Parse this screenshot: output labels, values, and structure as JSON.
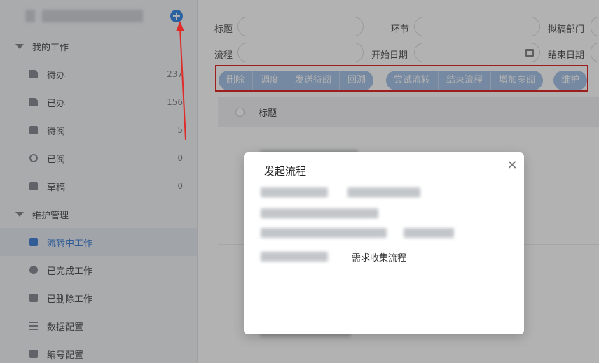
{
  "sidebar": {
    "add_icon": "plus-icon",
    "groups": [
      {
        "label": "我的工作"
      },
      {
        "label": "维护管理"
      }
    ],
    "my_work_items": [
      {
        "label": "待办",
        "count": "237",
        "icon": "document-icon"
      },
      {
        "label": "已办",
        "count": "156",
        "icon": "documents-icon"
      },
      {
        "label": "待阅",
        "count": "5",
        "icon": "clock-icon"
      },
      {
        "label": "已阅",
        "count": "0",
        "icon": "eye-icon"
      },
      {
        "label": "草稿",
        "count": "0",
        "icon": "draft-icon"
      }
    ],
    "maintenance_items": [
      {
        "label": "流转中工作",
        "icon": "monitor-icon",
        "active": true
      },
      {
        "label": "已完成工作",
        "icon": "check-circle-icon"
      },
      {
        "label": "已删除工作",
        "icon": "trash-icon"
      },
      {
        "label": "数据配置",
        "icon": "sliders-icon"
      },
      {
        "label": "编号配置",
        "icon": "clipboard-icon"
      }
    ]
  },
  "filters": {
    "title_label": "标题",
    "stage_label": "环节",
    "dept_label": "拟稿部门",
    "flow_label": "流程",
    "start_date_label": "开始日期",
    "end_date_label": "结束日期"
  },
  "toolbar": {
    "group1": [
      "删除",
      "调度",
      "发送待阅",
      "回溯"
    ],
    "group2": [
      "尝试流转",
      "结束流程",
      "增加参阅"
    ],
    "group3": [
      "维护"
    ]
  },
  "table": {
    "header_title": "标题"
  },
  "dialog": {
    "title": "发起流程",
    "close_icon": "close-icon",
    "flow_item": "需求收集流程"
  },
  "colors": {
    "accent": "#3d8be6",
    "toolbar_button": "#a9c4e8",
    "annotation_red": "#e02b2b"
  }
}
